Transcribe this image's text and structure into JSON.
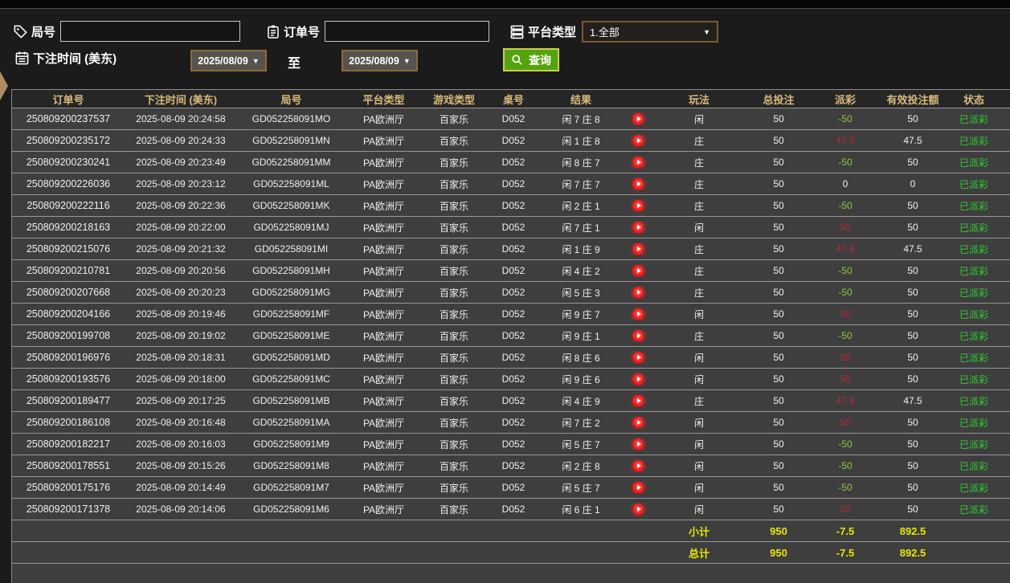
{
  "toolbar": {
    "round_label": "局号",
    "round_value": "",
    "order_label": "订单号",
    "order_value": "",
    "platform_label": "平台类型",
    "platform_value": "1.全部",
    "bet_time_label": "下注时间 (美东)",
    "date_from": "2025/08/09",
    "to_label": "至",
    "date_to": "2025/08/09",
    "search_label": "查询"
  },
  "colors": {
    "header_text": "#d9ba7c",
    "row_bg": "#3e3e3e",
    "payout_win_red": "#b5283c",
    "payout_loss_green": "#8dc63f",
    "status_green": "#33cc33",
    "totals_yellow": "#e8e800",
    "query_button_green": "#54a30f",
    "date_border_brown": "#8a6b3a"
  },
  "table": {
    "columns": [
      "订单号",
      "下注时间 (美东)",
      "局号",
      "平台类型",
      "游戏类型",
      "桌号",
      "结果",
      "",
      "玩法",
      "总投注",
      "派彩",
      "有效投注额",
      "状态"
    ],
    "rows": [
      {
        "order_id": "250809200237537",
        "bet_time": "2025-08-09 20:24:58",
        "round_id": "GD052258091MO",
        "platform": "PA欧洲厅",
        "game_type": "百家乐",
        "table_no": "D052",
        "result": "闲 7 庄 8",
        "play": "闲",
        "total_bet": "50",
        "payout": "-50",
        "payout_tone": "neg",
        "valid_bet": "50",
        "status": "已派彩"
      },
      {
        "order_id": "250809200235172",
        "bet_time": "2025-08-09 20:24:33",
        "round_id": "GD052258091MN",
        "platform": "PA欧洲厅",
        "game_type": "百家乐",
        "table_no": "D052",
        "result": "闲 1 庄 8",
        "play": "庄",
        "total_bet": "50",
        "payout": "47.5",
        "payout_tone": "pos",
        "valid_bet": "47.5",
        "status": "已派彩"
      },
      {
        "order_id": "250809200230241",
        "bet_time": "2025-08-09 20:23:49",
        "round_id": "GD052258091MM",
        "platform": "PA欧洲厅",
        "game_type": "百家乐",
        "table_no": "D052",
        "result": "闲 8 庄 7",
        "play": "庄",
        "total_bet": "50",
        "payout": "-50",
        "payout_tone": "neg",
        "valid_bet": "50",
        "status": "已派彩"
      },
      {
        "order_id": "250809200226036",
        "bet_time": "2025-08-09 20:23:12",
        "round_id": "GD052258091ML",
        "platform": "PA欧洲厅",
        "game_type": "百家乐",
        "table_no": "D052",
        "result": "闲 7 庄 7",
        "play": "庄",
        "total_bet": "50",
        "payout": "0",
        "payout_tone": "zero",
        "valid_bet": "0",
        "status": "已派彩"
      },
      {
        "order_id": "250809200222116",
        "bet_time": "2025-08-09 20:22:36",
        "round_id": "GD052258091MK",
        "platform": "PA欧洲厅",
        "game_type": "百家乐",
        "table_no": "D052",
        "result": "闲 2 庄 1",
        "play": "庄",
        "total_bet": "50",
        "payout": "-50",
        "payout_tone": "neg",
        "valid_bet": "50",
        "status": "已派彩"
      },
      {
        "order_id": "250809200218163",
        "bet_time": "2025-08-09 20:22:00",
        "round_id": "GD052258091MJ",
        "platform": "PA欧洲厅",
        "game_type": "百家乐",
        "table_no": "D052",
        "result": "闲 7 庄 1",
        "play": "闲",
        "total_bet": "50",
        "payout": "50",
        "payout_tone": "pos",
        "valid_bet": "50",
        "status": "已派彩"
      },
      {
        "order_id": "250809200215076",
        "bet_time": "2025-08-09 20:21:32",
        "round_id": "GD052258091MI",
        "platform": "PA欧洲厅",
        "game_type": "百家乐",
        "table_no": "D052",
        "result": "闲 1 庄 9",
        "play": "庄",
        "total_bet": "50",
        "payout": "47.5",
        "payout_tone": "pos",
        "valid_bet": "47.5",
        "status": "已派彩"
      },
      {
        "order_id": "250809200210781",
        "bet_time": "2025-08-09 20:20:56",
        "round_id": "GD052258091MH",
        "platform": "PA欧洲厅",
        "game_type": "百家乐",
        "table_no": "D052",
        "result": "闲 4 庄 2",
        "play": "庄",
        "total_bet": "50",
        "payout": "-50",
        "payout_tone": "neg",
        "valid_bet": "50",
        "status": "已派彩"
      },
      {
        "order_id": "250809200207668",
        "bet_time": "2025-08-09 20:20:23",
        "round_id": "GD052258091MG",
        "platform": "PA欧洲厅",
        "game_type": "百家乐",
        "table_no": "D052",
        "result": "闲 5 庄 3",
        "play": "庄",
        "total_bet": "50",
        "payout": "-50",
        "payout_tone": "neg",
        "valid_bet": "50",
        "status": "已派彩"
      },
      {
        "order_id": "250809200204166",
        "bet_time": "2025-08-09 20:19:46",
        "round_id": "GD052258091MF",
        "platform": "PA欧洲厅",
        "game_type": "百家乐",
        "table_no": "D052",
        "result": "闲 9 庄 7",
        "play": "闲",
        "total_bet": "50",
        "payout": "50",
        "payout_tone": "pos",
        "valid_bet": "50",
        "status": "已派彩"
      },
      {
        "order_id": "250809200199708",
        "bet_time": "2025-08-09 20:19:02",
        "round_id": "GD052258091ME",
        "platform": "PA欧洲厅",
        "game_type": "百家乐",
        "table_no": "D052",
        "result": "闲 9 庄 1",
        "play": "庄",
        "total_bet": "50",
        "payout": "-50",
        "payout_tone": "neg",
        "valid_bet": "50",
        "status": "已派彩"
      },
      {
        "order_id": "250809200196976",
        "bet_time": "2025-08-09 20:18:31",
        "round_id": "GD052258091MD",
        "platform": "PA欧洲厅",
        "game_type": "百家乐",
        "table_no": "D052",
        "result": "闲 8 庄 6",
        "play": "闲",
        "total_bet": "50",
        "payout": "50",
        "payout_tone": "pos",
        "valid_bet": "50",
        "status": "已派彩"
      },
      {
        "order_id": "250809200193576",
        "bet_time": "2025-08-09 20:18:00",
        "round_id": "GD052258091MC",
        "platform": "PA欧洲厅",
        "game_type": "百家乐",
        "table_no": "D052",
        "result": "闲 9 庄 6",
        "play": "闲",
        "total_bet": "50",
        "payout": "50",
        "payout_tone": "pos",
        "valid_bet": "50",
        "status": "已派彩"
      },
      {
        "order_id": "250809200189477",
        "bet_time": "2025-08-09 20:17:25",
        "round_id": "GD052258091MB",
        "platform": "PA欧洲厅",
        "game_type": "百家乐",
        "table_no": "D052",
        "result": "闲 4 庄 9",
        "play": "庄",
        "total_bet": "50",
        "payout": "47.5",
        "payout_tone": "pos",
        "valid_bet": "47.5",
        "status": "已派彩"
      },
      {
        "order_id": "250809200186108",
        "bet_time": "2025-08-09 20:16:48",
        "round_id": "GD052258091MA",
        "platform": "PA欧洲厅",
        "game_type": "百家乐",
        "table_no": "D052",
        "result": "闲 7 庄 2",
        "play": "闲",
        "total_bet": "50",
        "payout": "50",
        "payout_tone": "pos",
        "valid_bet": "50",
        "status": "已派彩"
      },
      {
        "order_id": "250809200182217",
        "bet_time": "2025-08-09 20:16:03",
        "round_id": "GD052258091M9",
        "platform": "PA欧洲厅",
        "game_type": "百家乐",
        "table_no": "D052",
        "result": "闲 5 庄 7",
        "play": "闲",
        "total_bet": "50",
        "payout": "-50",
        "payout_tone": "neg",
        "valid_bet": "50",
        "status": "已派彩"
      },
      {
        "order_id": "250809200178551",
        "bet_time": "2025-08-09 20:15:26",
        "round_id": "GD052258091M8",
        "platform": "PA欧洲厅",
        "game_type": "百家乐",
        "table_no": "D052",
        "result": "闲 2 庄 8",
        "play": "闲",
        "total_bet": "50",
        "payout": "-50",
        "payout_tone": "neg",
        "valid_bet": "50",
        "status": "已派彩"
      },
      {
        "order_id": "250809200175176",
        "bet_time": "2025-08-09 20:14:49",
        "round_id": "GD052258091M7",
        "platform": "PA欧洲厅",
        "game_type": "百家乐",
        "table_no": "D052",
        "result": "闲 5 庄 7",
        "play": "闲",
        "total_bet": "50",
        "payout": "-50",
        "payout_tone": "neg",
        "valid_bet": "50",
        "status": "已派彩"
      },
      {
        "order_id": "250809200171378",
        "bet_time": "2025-08-09 20:14:06",
        "round_id": "GD052258091M6",
        "platform": "PA欧洲厅",
        "game_type": "百家乐",
        "table_no": "D052",
        "result": "闲 6 庄 1",
        "play": "闲",
        "total_bet": "50",
        "payout": "50",
        "payout_tone": "pos",
        "valid_bet": "50",
        "status": "已派彩"
      }
    ],
    "subtotal": {
      "label": "小计",
      "total_bet": "950",
      "payout": "-7.5",
      "valid_bet": "892.5"
    },
    "grand_total": {
      "label": "总计",
      "total_bet": "950",
      "payout": "-7.5",
      "valid_bet": "892.5"
    }
  }
}
